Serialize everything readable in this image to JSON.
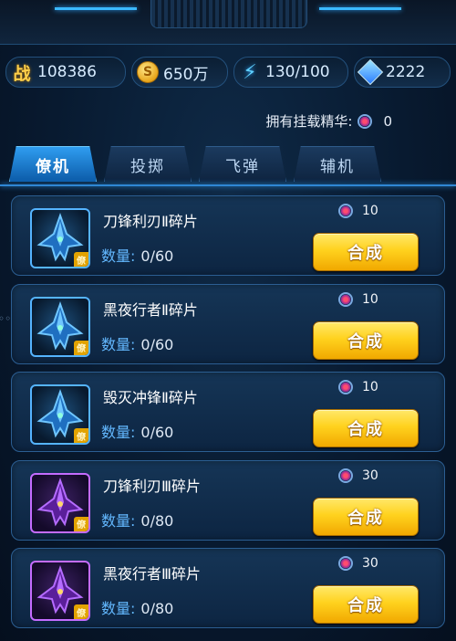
{
  "status": {
    "power_icon": "战",
    "power_value": "108386",
    "gold_icon": "S",
    "gold_value": "650万",
    "energy_icon": "lightning-icon",
    "energy_value": "130/100",
    "diamond_icon": "diamond-icon",
    "diamond_value": "2222"
  },
  "essence": {
    "label": "拥有挂载精华:",
    "count": "0"
  },
  "tabs": [
    {
      "label": "僚机",
      "active": true
    },
    {
      "label": "投掷",
      "active": false
    },
    {
      "label": "飞弹",
      "active": false
    },
    {
      "label": "辅机",
      "active": false
    }
  ],
  "items": [
    {
      "name": "刀锋利刃Ⅱ碎片",
      "qty_label": "数量:",
      "qty": "0/60",
      "cost": "10",
      "button": "合成",
      "badge": "僚",
      "rarity": "blue"
    },
    {
      "name": "黑夜行者Ⅱ碎片",
      "qty_label": "数量:",
      "qty": "0/60",
      "cost": "10",
      "button": "合成",
      "badge": "僚",
      "rarity": "blue"
    },
    {
      "name": "毁灭冲锋Ⅱ碎片",
      "qty_label": "数量:",
      "qty": "0/60",
      "cost": "10",
      "button": "合成",
      "badge": "僚",
      "rarity": "blue"
    },
    {
      "name": "刀锋利刃Ⅲ碎片",
      "qty_label": "数量:",
      "qty": "0/80",
      "cost": "30",
      "button": "合成",
      "badge": "僚",
      "rarity": "purple"
    },
    {
      "name": "黑夜行者Ⅲ碎片",
      "qty_label": "数量:",
      "qty": "0/80",
      "cost": "30",
      "button": "合成",
      "badge": "僚",
      "rarity": "purple"
    }
  ],
  "colors": {
    "accent": "#2f9df0",
    "button": "#ffd21e",
    "blue_frame": "#55b4ff",
    "purple_frame": "#c46cff"
  }
}
